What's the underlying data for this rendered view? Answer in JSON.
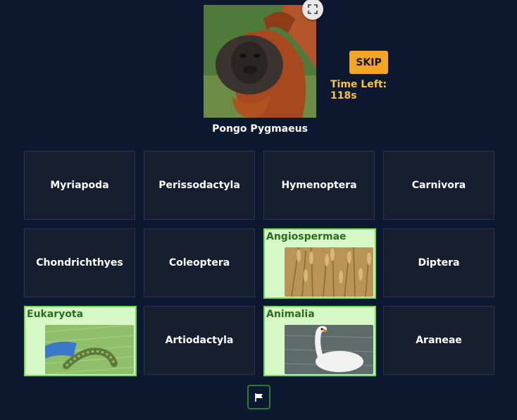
{
  "subject": {
    "name": "Pongo Pygmaeus",
    "image_icon": "orangutan-photo"
  },
  "controls": {
    "skip_label": "SKIP",
    "timer_text": "Time Left: 118s",
    "fullscreen_icon": "fullscreen-icon",
    "flag_icon": "flag-icon"
  },
  "grid": {
    "tiles": [
      {
        "label": "Myriapoda",
        "state": "default"
      },
      {
        "label": "Perissodactyla",
        "state": "default"
      },
      {
        "label": "Hymenoptera",
        "state": "default"
      },
      {
        "label": "Carnivora",
        "state": "default"
      },
      {
        "label": "Chondrichthyes",
        "state": "default"
      },
      {
        "label": "Coleoptera",
        "state": "default"
      },
      {
        "label": "Angiospermae",
        "state": "correct",
        "image": "wheat-field-photo"
      },
      {
        "label": "Diptera",
        "state": "default"
      },
      {
        "label": "Eukaryota",
        "state": "correct",
        "image": "caterpillar-photo"
      },
      {
        "label": "Artiodactyla",
        "state": "default"
      },
      {
        "label": "Animalia",
        "state": "correct",
        "image": "swan-photo"
      },
      {
        "label": "Araneae",
        "state": "default"
      }
    ]
  },
  "colors": {
    "background": "#0d1831",
    "tile": "#171e2f",
    "correct_fill": "#d7f8c7",
    "correct_border": "#6dde52",
    "correct_text": "#2b6d1c",
    "skip": "#f5a524",
    "timer": "#f5c542"
  }
}
